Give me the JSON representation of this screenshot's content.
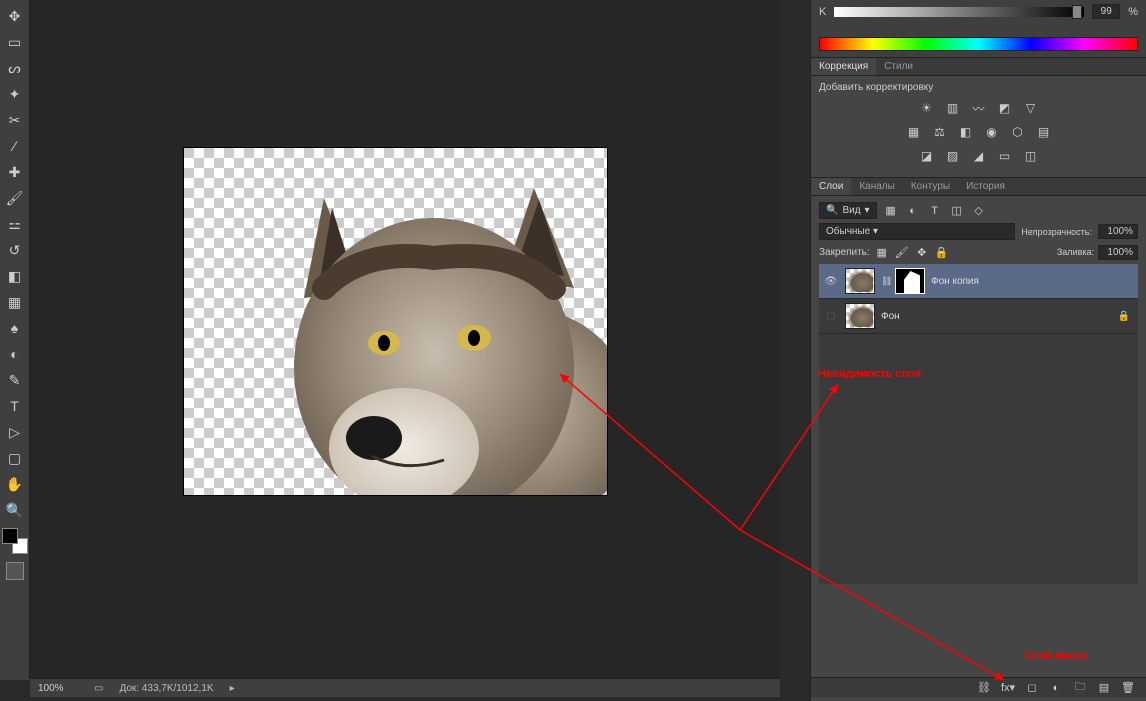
{
  "toolbar": {
    "tools": [
      "move",
      "marquee",
      "lasso",
      "wand",
      "crop",
      "eyedropper",
      "heal",
      "brush",
      "stamp",
      "history",
      "eraser",
      "gradient",
      "blur",
      "dodge",
      "pen",
      "type",
      "path",
      "shape",
      "hand",
      "zoom"
    ]
  },
  "status": {
    "zoom": "100%",
    "doc_info": "Док: 433,7K/1012,1K"
  },
  "color_panel": {
    "channel": "K",
    "value": "99",
    "percent": "%"
  },
  "adjustments": {
    "tab_adjustments": "Коррекция",
    "tab_styles": "Стили",
    "add_label": "Добавить корректировку"
  },
  "layers_panel": {
    "tab_layers": "Слои",
    "tab_channels": "Каналы",
    "tab_paths": "Контуры",
    "tab_history": "История",
    "filter_label": "Вид",
    "blend_mode": "Обычные",
    "opacity_label": "Непрозрачность:",
    "opacity_value": "100%",
    "lock_label": "Закрепить:",
    "fill_label": "Заливка:",
    "fill_value": "100%",
    "layers": [
      {
        "name": "Фон копия",
        "visible": true,
        "selected": true,
        "has_mask": true,
        "locked": false
      },
      {
        "name": "Фон",
        "visible": false,
        "selected": false,
        "has_mask": false,
        "locked": true
      }
    ]
  },
  "annotations": {
    "visibility": "Невидимость слоя",
    "mask": "Слой маска"
  }
}
